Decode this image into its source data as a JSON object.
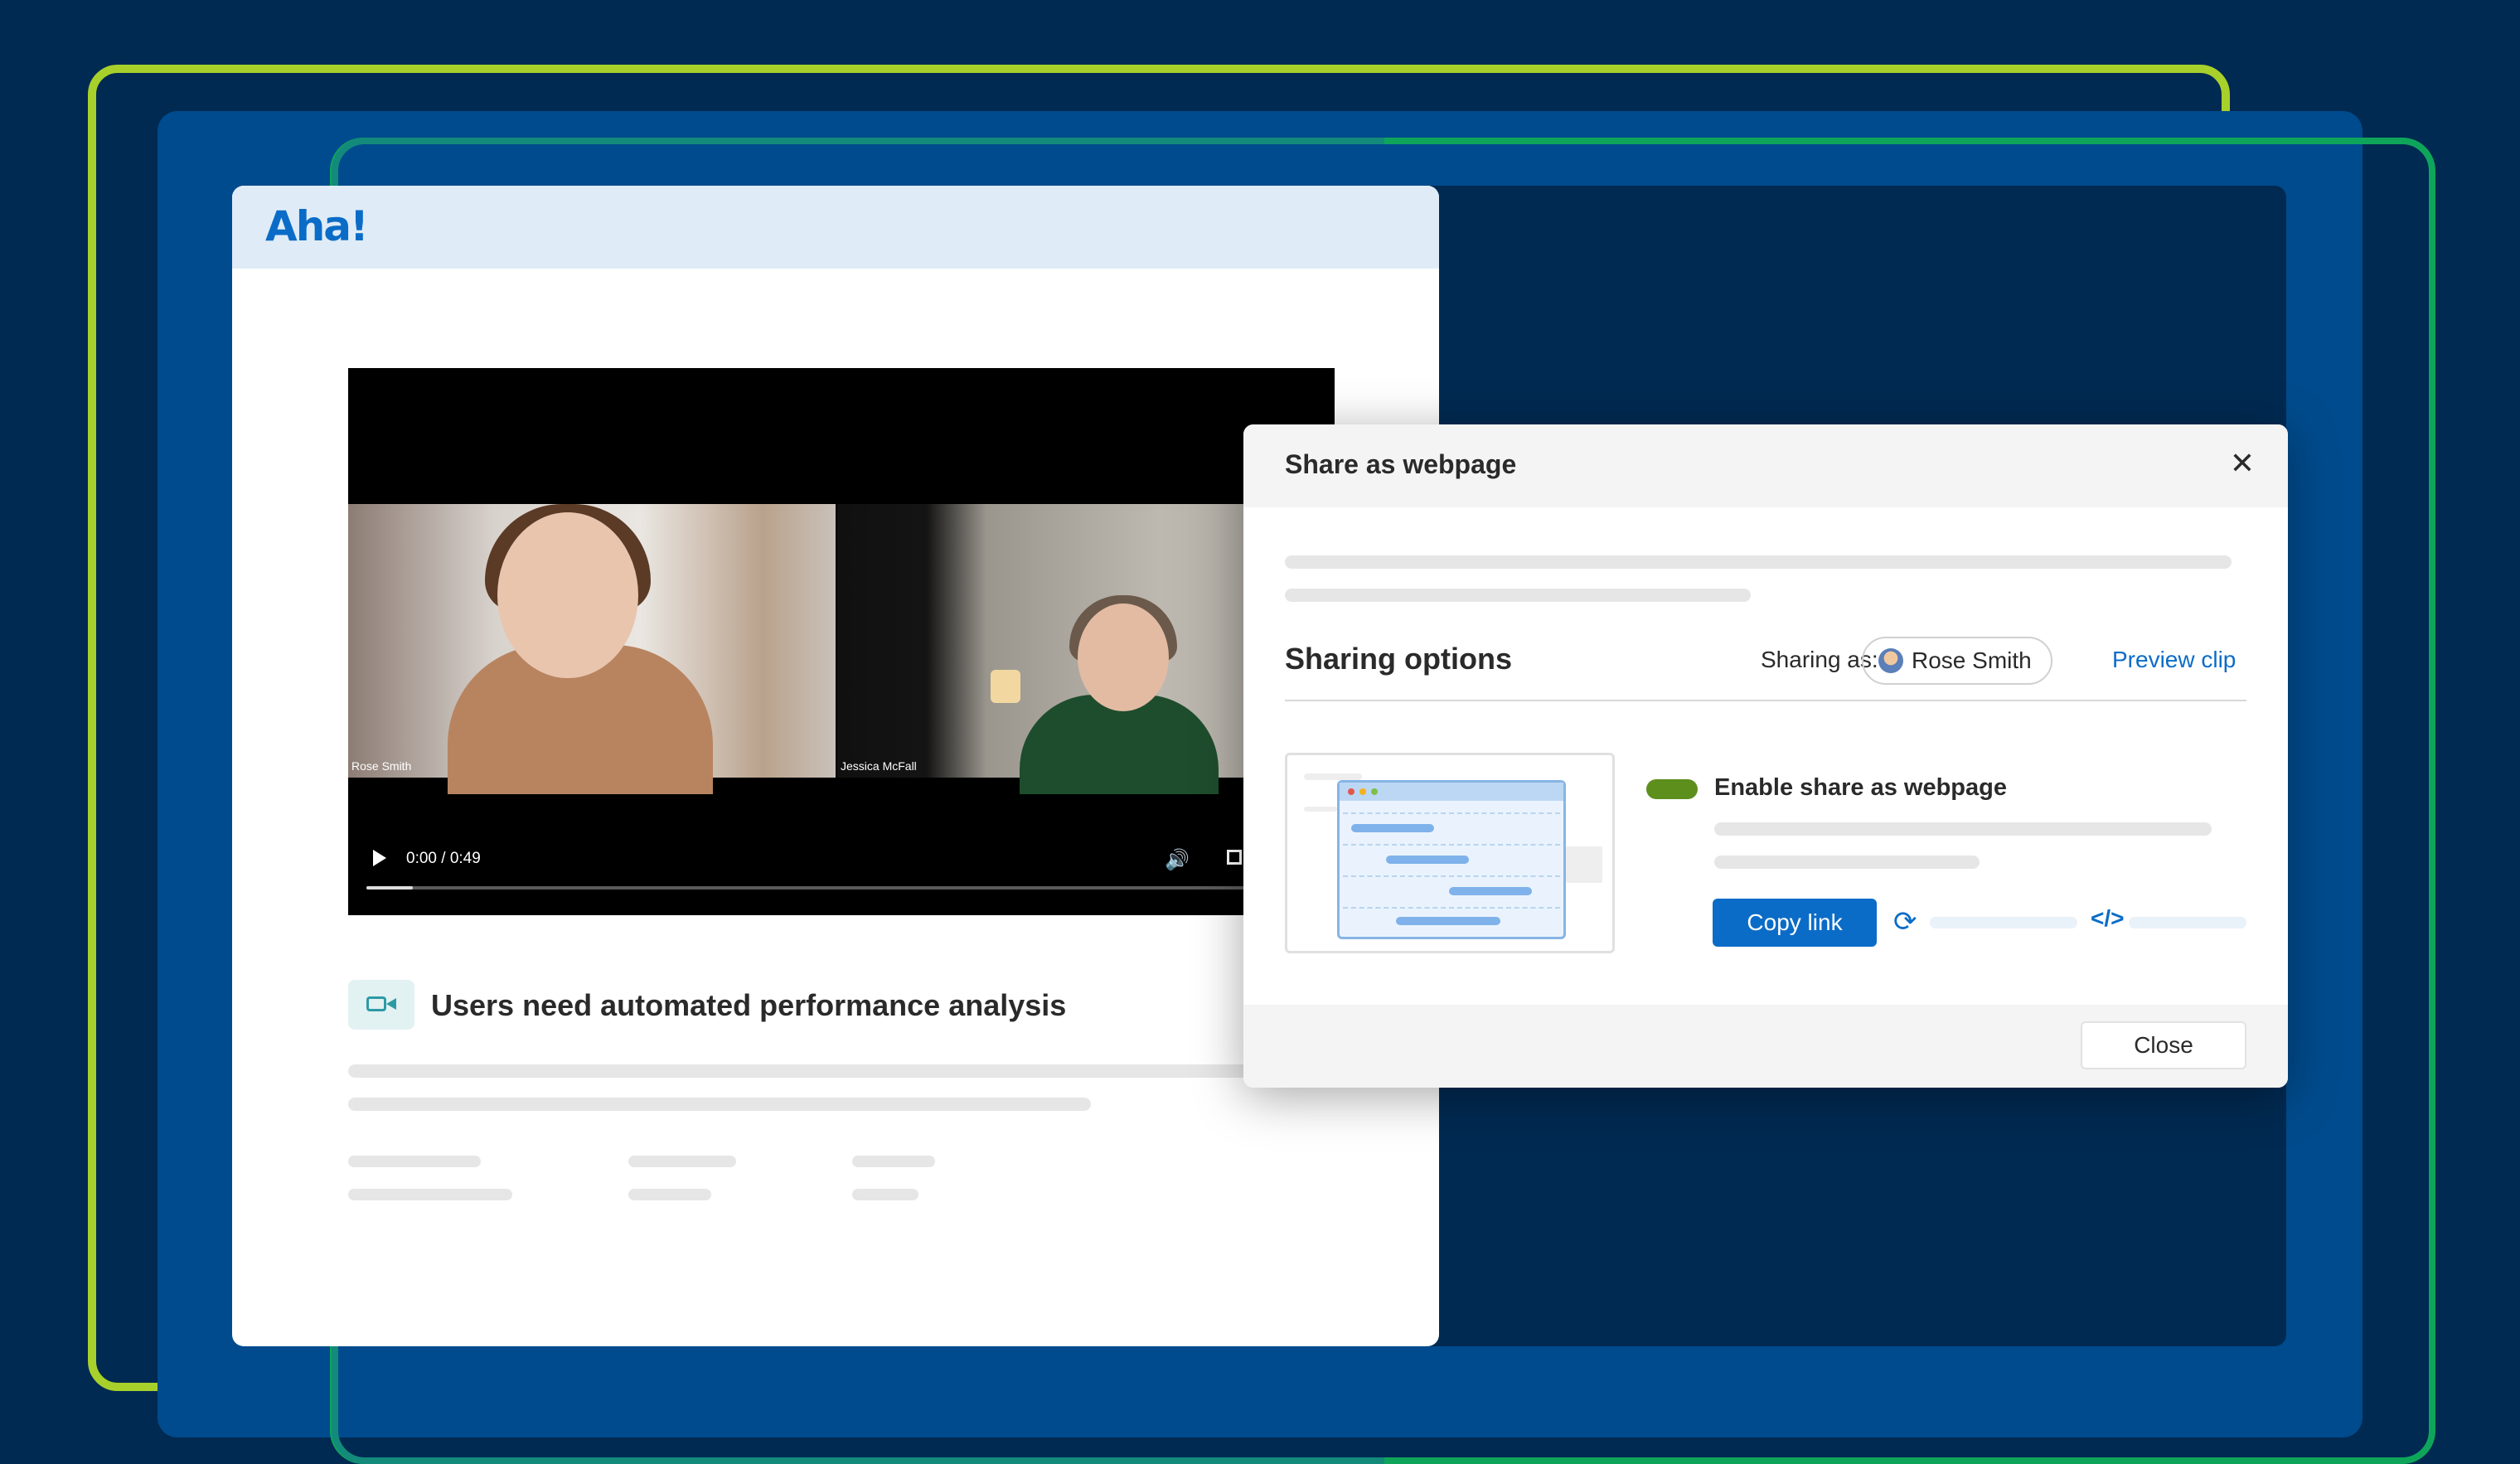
{
  "app": {
    "logo": "Aha!"
  },
  "video": {
    "participants": [
      {
        "name": "Rose Smith"
      },
      {
        "name": "Jessica McFall"
      }
    ],
    "time": "0:00 / 0:49",
    "progress": 0.05
  },
  "note": {
    "title": "Users need automated performance analysis",
    "icon": "video-camera-icon"
  },
  "modal": {
    "title": "Share as webpage",
    "close_icon": "close-icon",
    "sharing_options_title": "Sharing options",
    "sharing_as_label": "Sharing as:",
    "user_name": "Rose Smith",
    "preview_clip_label": "Preview clip",
    "toggle_label": "Enable share as webpage",
    "toggle_on": true,
    "copy_link_label": "Copy link",
    "refresh_icon": "refresh-icon",
    "embed_icon": "code-embed-icon",
    "close_button_label": "Close"
  },
  "colors": {
    "background": "#002a52",
    "accent_blue": "#0b6cc7",
    "toggle_green": "#5d8f1d",
    "frame_lime": "#a8d02b",
    "frame_green": "#0ea55b"
  }
}
